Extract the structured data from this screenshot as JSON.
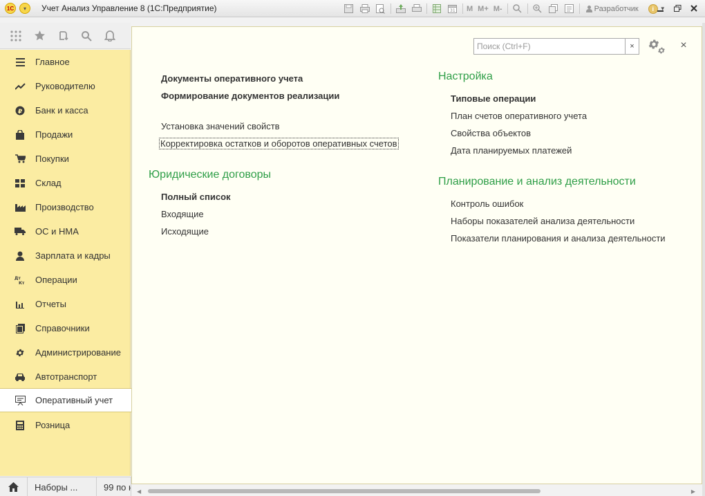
{
  "window": {
    "logo_text": "1С",
    "title": "Учет Анализ Управление 8  (1С:Предприятие)",
    "toolbar_m_labels": [
      "M",
      "M+",
      "M-"
    ],
    "user": "Разработчик",
    "info_label": "i"
  },
  "sidebar": {
    "items": [
      {
        "label": "Главное",
        "icon": "menu-lines-icon"
      },
      {
        "label": "Руководителю",
        "icon": "trend-icon"
      },
      {
        "label": "Банк и касса",
        "icon": "ruble-icon"
      },
      {
        "label": "Продажи",
        "icon": "bag-icon"
      },
      {
        "label": "Покупки",
        "icon": "cart-icon"
      },
      {
        "label": "Склад",
        "icon": "warehouse-icon"
      },
      {
        "label": "Производство",
        "icon": "factory-icon"
      },
      {
        "label": "ОС и НМА",
        "icon": "truck-icon"
      },
      {
        "label": "Зарплата и кадры",
        "icon": "person-icon"
      },
      {
        "label": "Операции",
        "icon": "dt-kt-icon"
      },
      {
        "label": "Отчеты",
        "icon": "bar-chart-icon"
      },
      {
        "label": "Справочники",
        "icon": "books-icon"
      },
      {
        "label": "Администрирование",
        "icon": "gear-icon"
      },
      {
        "label": "Автотранспорт",
        "icon": "car-icon"
      },
      {
        "label": "Оперативный учет",
        "icon": "presentation-icon",
        "active": true
      },
      {
        "label": "Розница",
        "icon": "calculator-icon"
      }
    ]
  },
  "search": {
    "placeholder": "Поиск (Ctrl+F)",
    "value": "",
    "clear_label": "×"
  },
  "main": {
    "close_label": "×",
    "left_links_bold": [
      "Документы оперативного учета",
      "Формирование документов реализации"
    ],
    "left_links": [
      "Установка значений свойств",
      "Корректировка остатков и оборотов оперативных счетов"
    ],
    "legal": {
      "title": "Юридические договоры",
      "items": [
        "Полный список",
        "Входящие",
        "Исходящие"
      ]
    },
    "settings": {
      "title": "Настройка",
      "items": [
        "Типовые операции",
        "План счетов оперативного учета",
        "Свойства объектов",
        "Дата планируемых платежей"
      ]
    },
    "planning": {
      "title": "Планирование и анализ деятельности",
      "items": [
        "Контроль ошибок",
        "Наборы показателей анализа деятельности",
        "Показатели планирования и анализа деятельности"
      ]
    }
  },
  "bottom": {
    "tabs": [
      "Наборы ...",
      "99 по н"
    ]
  },
  "colors": {
    "sidebar_bg": "#fbeca2",
    "group_title": "#2e9e47",
    "content_bg": "#fffff4"
  }
}
